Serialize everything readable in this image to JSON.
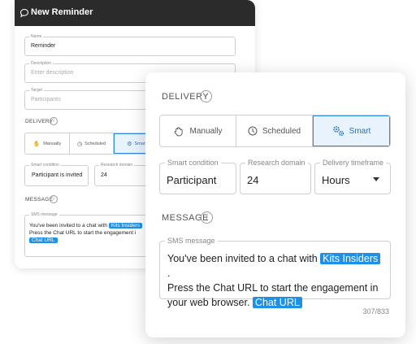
{
  "bg": {
    "title": "New Reminder",
    "name": {
      "label": "Name",
      "value": "Reminder"
    },
    "description": {
      "label": "Description",
      "placeholder": "Enter description"
    },
    "target": {
      "label": "Target",
      "placeholder": "Participants"
    },
    "delivery_label": "DELIVERY",
    "delivery_options": [
      "Manually",
      "Scheduled",
      "Smart"
    ],
    "smart_condition": {
      "label": "Smart condition",
      "value": "Participant is invited"
    },
    "research_domain": {
      "label": "Research domain",
      "value": "24"
    },
    "message_label": "MESSAGE",
    "sms": {
      "label": "SMS message",
      "pre": "You've been invited to a chat with ",
      "tag1": "Kits Insiders",
      "line2": "Press the Chat URL to start the engagement i",
      "tag2": "Chat URL"
    }
  },
  "card": {
    "delivery_label": "DELIVERY",
    "delivery_options": [
      "Manually",
      "Scheduled",
      "Smart"
    ],
    "active_option": "Smart",
    "smart_condition": {
      "label": "Smart condition",
      "value": "Participant"
    },
    "research_domain": {
      "label": "Research domain",
      "value": "24"
    },
    "delivery_timeframe": {
      "label": "Delivery timeframe",
      "value": "Hours"
    },
    "message_label": "MESSAGE",
    "sms": {
      "label": "SMS message",
      "pre": "You've been invited to a chat with ",
      "tag1": "Kits Insiders",
      "post": " .",
      "line2": "Press the Chat URL to start the engagement in",
      "line3": "your web browser. ",
      "tag2": "Chat URL"
    },
    "counter": "307/833"
  },
  "colors": {
    "accent": "#1e90e6",
    "active_bg": "#e9f3fd",
    "titlebar": "#2b2b2b"
  }
}
